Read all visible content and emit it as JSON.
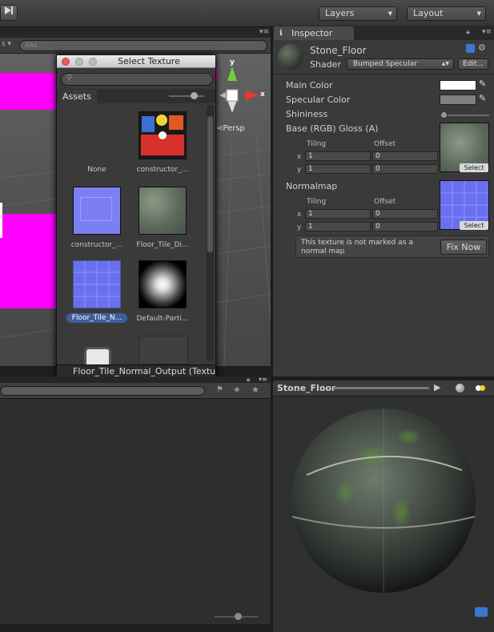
{
  "toolbar": {
    "step_icon": "step-forward-icon",
    "layers_label": "Layers",
    "layout_label": "Layout"
  },
  "scene": {
    "search_placeholder": "All",
    "gizmo_y": "y",
    "gizmo_x": "x",
    "persp_label": "Persp"
  },
  "picker": {
    "title": "Select Texture",
    "tab_assets": "Assets",
    "items": [
      {
        "label": "None"
      },
      {
        "label": "constructor_..."
      },
      {
        "label": "constructor_..."
      },
      {
        "label": "Floor_Tile_Di..."
      },
      {
        "label": "Floor_Tile_N..."
      },
      {
        "label": "Default-Parti..."
      }
    ],
    "status": "Floor_Tile_Normal_Output (Textu"
  },
  "inspector": {
    "tab_label": "Inspector",
    "material_name": "Stone_Floor",
    "shader_label": "Shader",
    "shader_value": "Bumped Specular",
    "edit_label": "Edit...",
    "main_color_label": "Main Color",
    "specular_color_label": "Specular Color",
    "shininess_label": "Shininess",
    "shininess_value": 0.08,
    "base_label": "Base (RGB) Gloss (A)",
    "tiling_label": "Tiling",
    "offset_label": "Offset",
    "x_label": "x",
    "y_label": "y",
    "base_tiling_x": "1",
    "base_tiling_y": "1",
    "base_offset_x": "0",
    "base_offset_y": "0",
    "normalmap_label": "Normalmap",
    "normal_tiling_x": "1",
    "normal_tiling_y": "1",
    "normal_offset_x": "0",
    "normal_offset_y": "0",
    "select_label": "Select",
    "warning": "This texture is not marked as a normal map",
    "fix_now_label": "Fix Now",
    "colors": {
      "main": "#ffffff",
      "specular": "#808080"
    }
  },
  "preview": {
    "title": "Stone_Floor"
  }
}
